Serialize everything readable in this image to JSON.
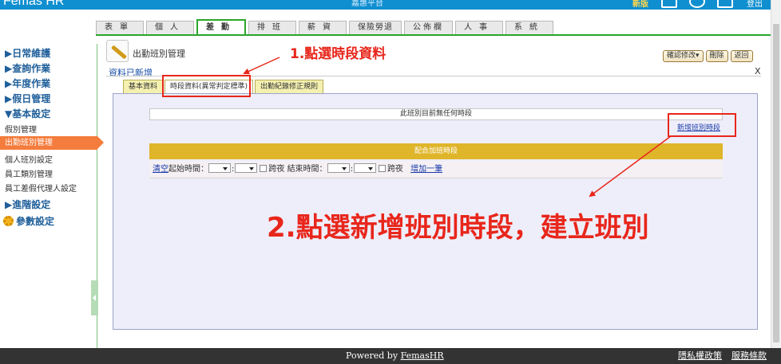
{
  "app": {
    "logo_text": "Femas HR",
    "company": "嘉惠平台",
    "highlight_text": "新版",
    "user_text": "登出"
  },
  "menu_tabs": [
    "表單",
    "個人",
    "差勤",
    "排班",
    "薪資",
    "保險勞退",
    "公佈欄",
    "人事",
    "系統"
  ],
  "active_menu_tab": "差勤",
  "sidebar": {
    "cat_daily": "▶日常維護",
    "cat_query": "▶查詢作業",
    "cat_yearly": "▶年度作業",
    "cat_holiday": "▶假日管理",
    "cat_basic": "▼基本設定",
    "item_leave": "假別管理",
    "item_attendance": "出勤班別管理",
    "item_personal": "個人班別設定",
    "item_employee": "員工類別管理",
    "item_deputy": "員工差假代理人設定",
    "cat_advanced": "▶進階設定",
    "cat_params": "參數設定"
  },
  "page": {
    "title": "出勤班別管理",
    "saved_message": "資料已新增",
    "close_label": "X",
    "confirm_button": "確認修改▾",
    "delete_button": "刪除",
    "back_button": "返回"
  },
  "subtabs": [
    "基本資料",
    "時段資料(異常判定標準)",
    "出勤紀錄修正規則"
  ],
  "content": {
    "no_period_text": "此班別目前無任何時段",
    "new_period_link": "新增班別時段",
    "overtime_header": "配合加班時段",
    "clear_link": "清空",
    "start_time_label": "起始時間：",
    "overnight_label": "跨夜",
    "end_time_label": "結束時間：",
    "add_one_link": "增加一筆"
  },
  "annotations": {
    "step1": "1.點選時段資料",
    "step2": "2.點選新增班別時段，建立班別"
  },
  "footer": {
    "powered_prefix": "Powered by",
    "powered_link": "FemasHR",
    "privacy_link": "隱私權政策",
    "terms_link": "服務條款"
  }
}
